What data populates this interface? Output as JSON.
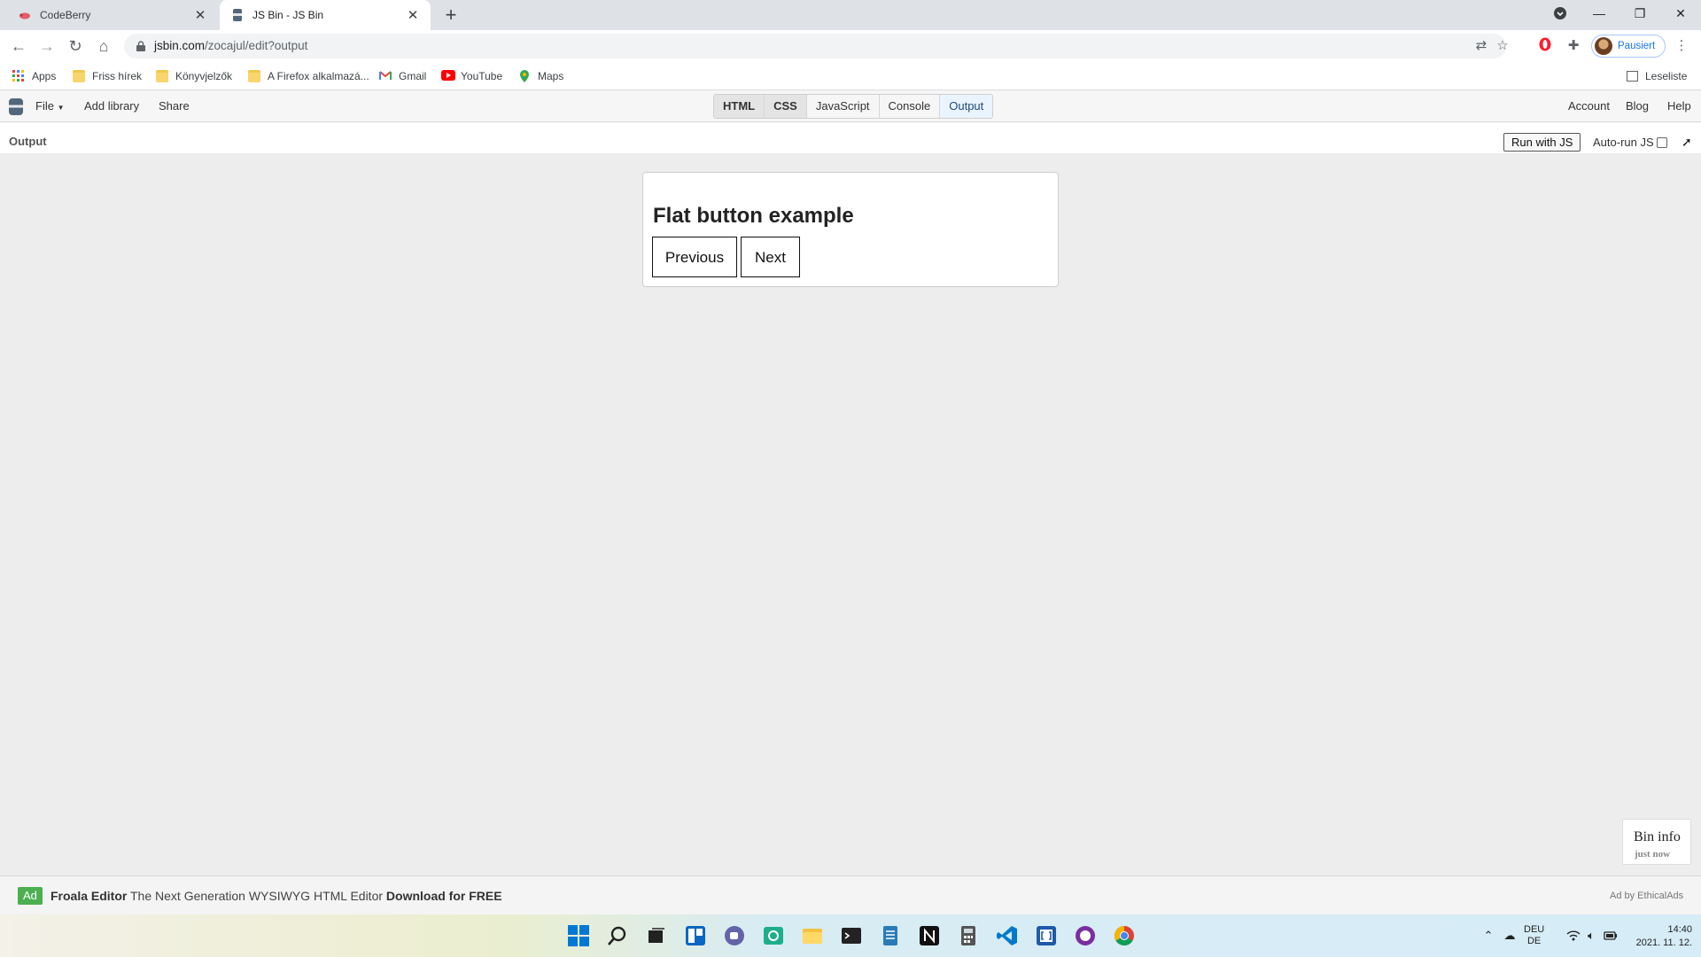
{
  "browser": {
    "tabs": [
      {
        "title": "CodeBerry",
        "active": false
      },
      {
        "title": "JS Bin - JS Bin",
        "active": true
      }
    ],
    "url_host": "jsbin.com",
    "url_path": "/zocajul/edit?output",
    "profile_label": "Pausiert",
    "bookmarks": [
      "Apps",
      "Friss hírek",
      "Könyvjelzők",
      "A Firefox alkalmazá...",
      "Gmail",
      "YouTube",
      "Maps"
    ],
    "reading_list": "Leseliste"
  },
  "jsbin": {
    "menu": {
      "file": "File",
      "add_library": "Add library",
      "share": "Share"
    },
    "panels": [
      "HTML",
      "CSS",
      "JavaScript",
      "Console",
      "Output"
    ],
    "right_links": {
      "account": "Account",
      "blog": "Blog",
      "help": "Help"
    },
    "output_label": "Output",
    "run_with_js": "Run with JS",
    "auto_run": "Auto-run JS",
    "auto_run_checked": false,
    "popout_icon": "arrow-up-right-icon"
  },
  "content": {
    "heading": "Flat button example",
    "buttons": {
      "previous": "Previous",
      "next": "Next"
    }
  },
  "bininfo": {
    "title": "Bin info",
    "subtitle": "just now"
  },
  "ad": {
    "tag": "Ad",
    "product": "Froala Editor",
    "tagline": "The Next Generation WYSIWYG HTML Editor",
    "cta": "Download for FREE",
    "by": "Ad by EthicalAds"
  },
  "taskbar": {
    "lang_top": "DEU",
    "lang_bottom": "DE",
    "time": "14:40",
    "date": "2021. 11. 12."
  },
  "colors": {
    "ad_green": "#4caf50",
    "accent": "#1a73e8"
  }
}
